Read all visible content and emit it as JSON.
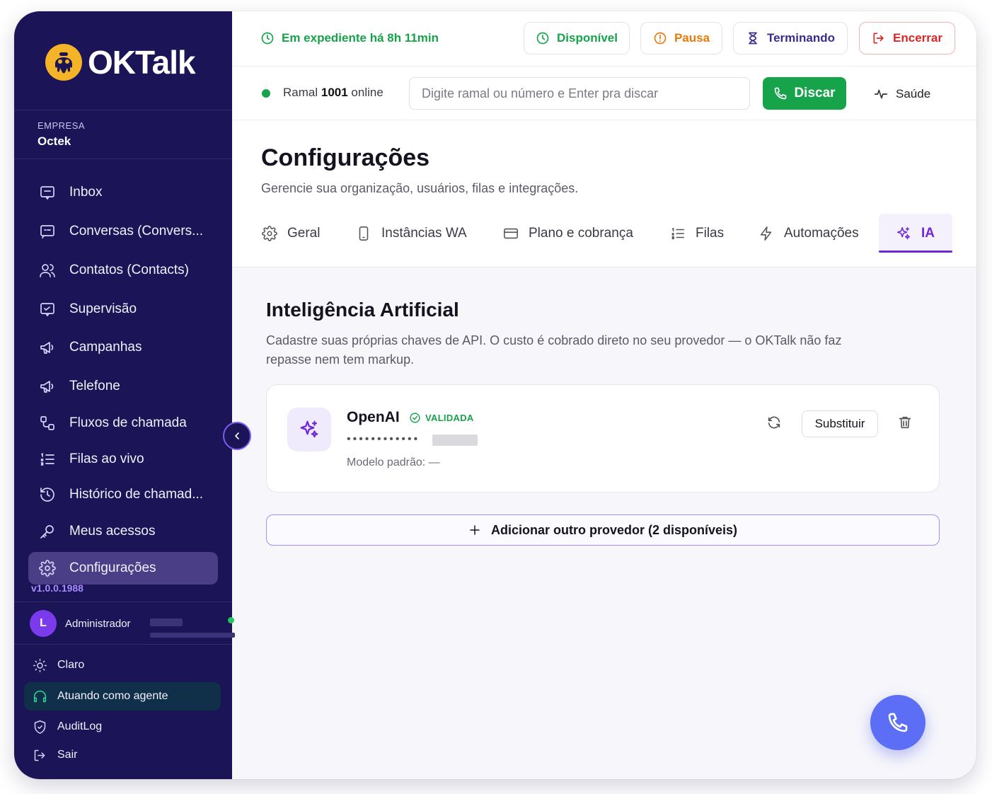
{
  "colors": {
    "sidebar_bg": "#1b1456",
    "accent_purple": "#6d28d9",
    "success_green": "#16a34a",
    "warning_orange": "#ea7a0c",
    "danger_red": "#dc2626",
    "fab_blue": "#5b6ef5"
  },
  "brand": {
    "name": "OKTalk",
    "logo_icon": "octopus-logo-icon"
  },
  "company": {
    "label": "EMPRESA",
    "name": "Octek"
  },
  "sidebar": {
    "items": [
      {
        "label": "Inbox",
        "icon": "inbox-icon"
      },
      {
        "label": "Conversas (Convers...",
        "icon": "chat-icon"
      },
      {
        "label": "Contatos (Contacts)",
        "icon": "users-icon"
      },
      {
        "label": "Supervisão",
        "icon": "monitor-chat-icon"
      },
      {
        "label": "Campanhas",
        "icon": "megaphone-icon"
      },
      {
        "label": "Telefone",
        "icon": "megaphone-icon"
      },
      {
        "label": "Fluxos de chamada",
        "icon": "flow-icon"
      },
      {
        "label": "Filas ao vivo",
        "icon": "list-ordered-icon"
      },
      {
        "label": "Histórico de chamad...",
        "icon": "history-icon"
      },
      {
        "label": "Meus acessos",
        "icon": "key-icon"
      },
      {
        "label": "Configurações",
        "icon": "gear-icon",
        "active": true
      }
    ],
    "version": "v1.0.0.1988",
    "user": {
      "initial": "L",
      "name": "Administrador"
    },
    "footer": [
      {
        "label": "Claro",
        "icon": "sun-icon"
      },
      {
        "label": "Atuando como agente",
        "icon": "headset-icon",
        "active": true
      },
      {
        "label": "AuditLog",
        "icon": "shield-icon"
      },
      {
        "label": "Sair",
        "icon": "logout-icon"
      }
    ]
  },
  "topbar": {
    "shift_status": "Em expediente há 8h 11min",
    "buttons": {
      "available": "Disponível",
      "pause": "Pausa",
      "ending": "Terminando",
      "end": "Encerrar"
    }
  },
  "dialbar": {
    "extension_prefix": "Ramal",
    "extension_number": "1001",
    "extension_suffix": "online",
    "dial_placeholder": "Digite ramal ou número e Enter pra discar",
    "dial_button": "Discar",
    "health_label": "Saúde"
  },
  "page": {
    "title": "Configurações",
    "subtitle": "Gerencie sua organização, usuários, filas e integrações.",
    "tabs": [
      {
        "label": "Geral",
        "icon": "gear-icon"
      },
      {
        "label": "Instâncias WA",
        "icon": "smartphone-icon"
      },
      {
        "label": "Plano e cobrança",
        "icon": "credit-card-icon"
      },
      {
        "label": "Filas",
        "icon": "list-ordered-icon"
      },
      {
        "label": "Automações",
        "icon": "lightning-icon"
      },
      {
        "label": "IA",
        "icon": "sparkles-icon",
        "active": true
      }
    ]
  },
  "ai": {
    "section_title": "Inteligência Artificial",
    "section_desc": "Cadastre suas próprias chaves de API. O custo é cobrado direto no seu provedor — o OKTalk não faz repasse nem tem markup.",
    "provider": {
      "name": "OpenAI",
      "status": "VALIDADA",
      "masked_key": "••••••••••••",
      "default_model": "Modelo padrão: —",
      "replace_label": "Substituir"
    },
    "add_provider_label": "Adicionar outro provedor (2 disponíveis)"
  }
}
